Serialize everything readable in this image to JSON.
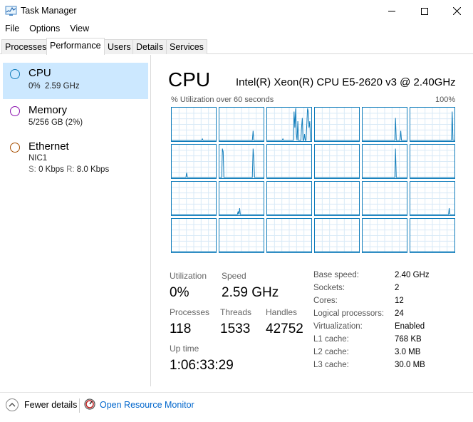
{
  "window": {
    "title": "Task Manager"
  },
  "menu": [
    "File",
    "Options",
    "View"
  ],
  "tabs": [
    "Processes",
    "Performance",
    "Users",
    "Details",
    "Services"
  ],
  "left": {
    "cpu": {
      "title": "CPU",
      "sub": "0%  2.59 GHz"
    },
    "memory": {
      "title": "Memory",
      "sub": "5/256 GB (2%)"
    },
    "ethernet": {
      "title": "Ethernet",
      "adapter": "NIC1",
      "s_label": "S:",
      "s_value": "0 Kbps",
      "r_label": "R:",
      "r_value": "8.0 Kbps"
    }
  },
  "main": {
    "title": "CPU",
    "model": "Intel(R) Xeon(R) CPU E5-2620 v3 @ 2.40GHz",
    "graph_label": "% Utilization over 60 seconds",
    "graph_max": "100%"
  },
  "stats": {
    "utilization_label": "Utilization",
    "utilization": "0%",
    "speed_label": "Speed",
    "speed": "2.59 GHz",
    "processes_label": "Processes",
    "processes": "118",
    "threads_label": "Threads",
    "threads": "1533",
    "handles_label": "Handles",
    "handles": "42752",
    "uptime_label": "Up time",
    "uptime": "1:06:33:29"
  },
  "info": [
    {
      "label": "Base speed:",
      "value": "2.40 GHz"
    },
    {
      "label": "Sockets:",
      "value": "2"
    },
    {
      "label": "Cores:",
      "value": "12"
    },
    {
      "label": "Logical processors:",
      "value": "24"
    },
    {
      "label": "Virtualization:",
      "value": "Enabled"
    },
    {
      "label": "L1 cache:",
      "value": "768 KB"
    },
    {
      "label": "L2 cache:",
      "value": "3.0 MB"
    },
    {
      "label": "L3 cache:",
      "value": "30.0 MB"
    }
  ],
  "bottom": {
    "fewer_details": "Fewer details",
    "resource_monitor": "Open Resource Monitor"
  },
  "colors": {
    "accent": "#117dbb",
    "selected": "#cce8ff",
    "cpu_circle": "#117dbb",
    "memory_circle": "#8b12ae",
    "ethernet_circle": "#a74f01",
    "link": "#0066cc"
  },
  "cpu_cores": [
    [
      0,
      0,
      0,
      0,
      0,
      0,
      0,
      0,
      0,
      0,
      0,
      0,
      0,
      0,
      0,
      0,
      0,
      0,
      0,
      0,
      0,
      0,
      0,
      0,
      0,
      0,
      0,
      0,
      0,
      0,
      0,
      0,
      0,
      0,
      0,
      0,
      0,
      0,
      0,
      0,
      0,
      5,
      0,
      0,
      0,
      0,
      0,
      0,
      0,
      0,
      0,
      0,
      0,
      0,
      0,
      0,
      0,
      0,
      0,
      0
    ],
    [
      0,
      0,
      0,
      0,
      0,
      0,
      0,
      0,
      0,
      0,
      0,
      0,
      0,
      0,
      0,
      0,
      0,
      0,
      0,
      0,
      0,
      0,
      0,
      0,
      0,
      0,
      0,
      0,
      0,
      0,
      0,
      0,
      0,
      0,
      0,
      0,
      0,
      0,
      0,
      0,
      0,
      0,
      0,
      0,
      0,
      30,
      0,
      0,
      0,
      0,
      0,
      0,
      0,
      0,
      0,
      0,
      0,
      0,
      0,
      0
    ],
    [
      0,
      0,
      0,
      0,
      0,
      0,
      0,
      0,
      0,
      0,
      0,
      0,
      0,
      0,
      0,
      0,
      0,
      0,
      0,
      0,
      0,
      5,
      0,
      0,
      0,
      0,
      0,
      0,
      0,
      0,
      0,
      0,
      0,
      0,
      0,
      0,
      90,
      40,
      100,
      20,
      0,
      60,
      0,
      0,
      0,
      0,
      40,
      70,
      0,
      0,
      20,
      0,
      0,
      50,
      100,
      90,
      40,
      60,
      0,
      0
    ],
    [
      0,
      0,
      0,
      0,
      0,
      0,
      0,
      0,
      0,
      0,
      0,
      0,
      0,
      0,
      0,
      0,
      0,
      0,
      0,
      0,
      0,
      0,
      0,
      0,
      0,
      0,
      0,
      0,
      0,
      0,
      0,
      0,
      0,
      0,
      0,
      0,
      0,
      0,
      0,
      0,
      0,
      0,
      0,
      0,
      0,
      0,
      0,
      0,
      0,
      0,
      0,
      0,
      0,
      0,
      0,
      0,
      0,
      0,
      0,
      0
    ],
    [
      0,
      0,
      0,
      0,
      0,
      0,
      0,
      0,
      0,
      0,
      0,
      0,
      0,
      0,
      0,
      0,
      0,
      0,
      0,
      0,
      0,
      0,
      0,
      0,
      0,
      0,
      0,
      0,
      0,
      0,
      0,
      0,
      0,
      0,
      0,
      0,
      0,
      0,
      0,
      0,
      0,
      0,
      0,
      0,
      70,
      0,
      0,
      0,
      0,
      0,
      0,
      30,
      0,
      0,
      0,
      0,
      0,
      0,
      0,
      0
    ],
    [
      0,
      0,
      0,
      0,
      0,
      0,
      0,
      0,
      0,
      0,
      0,
      0,
      0,
      0,
      0,
      0,
      0,
      0,
      0,
      0,
      0,
      0,
      0,
      0,
      0,
      0,
      0,
      0,
      0,
      0,
      0,
      0,
      0,
      0,
      0,
      0,
      0,
      0,
      0,
      0,
      0,
      0,
      0,
      0,
      0,
      0,
      0,
      0,
      0,
      0,
      0,
      0,
      0,
      0,
      0,
      0,
      90,
      0,
      0,
      0
    ],
    [
      0,
      0,
      0,
      0,
      0,
      0,
      0,
      0,
      0,
      0,
      0,
      0,
      0,
      0,
      0,
      0,
      0,
      0,
      0,
      0,
      15,
      0,
      0,
      0,
      0,
      0,
      0,
      0,
      0,
      0,
      0,
      0,
      0,
      0,
      0,
      0,
      0,
      0,
      0,
      0,
      0,
      0,
      0,
      0,
      0,
      0,
      0,
      0,
      0,
      0,
      0,
      0,
      0,
      0,
      0,
      0,
      0,
      0,
      0,
      0
    ],
    [
      0,
      0,
      0,
      0,
      90,
      80,
      0,
      0,
      0,
      0,
      0,
      0,
      0,
      0,
      0,
      0,
      0,
      0,
      0,
      0,
      0,
      0,
      0,
      0,
      0,
      0,
      0,
      0,
      0,
      0,
      0,
      0,
      0,
      0,
      0,
      0,
      0,
      0,
      0,
      0,
      0,
      0,
      0,
      0,
      0,
      90,
      60,
      0,
      0,
      0,
      0,
      0,
      0,
      0,
      0,
      0,
      0,
      0,
      0,
      0
    ],
    [
      0,
      0,
      0,
      0,
      0,
      0,
      0,
      0,
      0,
      0,
      0,
      0,
      0,
      0,
      0,
      0,
      0,
      0,
      0,
      0,
      0,
      0,
      0,
      0,
      0,
      0,
      0,
      0,
      0,
      0,
      0,
      0,
      0,
      0,
      0,
      0,
      0,
      0,
      0,
      0,
      0,
      0,
      0,
      0,
      0,
      0,
      0,
      0,
      0,
      0,
      0,
      0,
      0,
      0,
      0,
      0,
      0,
      0,
      0,
      0
    ],
    [
      0,
      0,
      0,
      0,
      0,
      0,
      0,
      0,
      0,
      0,
      0,
      0,
      0,
      0,
      0,
      0,
      0,
      0,
      0,
      0,
      0,
      0,
      0,
      0,
      0,
      0,
      0,
      0,
      0,
      0,
      0,
      0,
      0,
      0,
      0,
      0,
      0,
      0,
      0,
      0,
      0,
      0,
      0,
      0,
      0,
      0,
      0,
      0,
      0,
      0,
      0,
      0,
      0,
      0,
      0,
      0,
      0,
      0,
      0,
      0
    ],
    [
      0,
      0,
      0,
      0,
      0,
      0,
      0,
      0,
      0,
      0,
      0,
      0,
      0,
      0,
      0,
      0,
      0,
      0,
      0,
      0,
      0,
      0,
      0,
      0,
      0,
      0,
      0,
      0,
      0,
      0,
      0,
      0,
      0,
      0,
      0,
      0,
      0,
      0,
      0,
      0,
      0,
      0,
      0,
      0,
      90,
      0,
      0,
      0,
      0,
      0,
      0,
      0,
      0,
      0,
      0,
      0,
      0,
      0,
      0,
      0
    ],
    [
      0,
      0,
      0,
      0,
      0,
      0,
      0,
      0,
      0,
      0,
      0,
      0,
      0,
      0,
      0,
      0,
      0,
      0,
      0,
      0,
      0,
      0,
      0,
      0,
      0,
      0,
      0,
      0,
      0,
      0,
      0,
      0,
      0,
      0,
      0,
      0,
      0,
      0,
      0,
      0,
      0,
      0,
      0,
      0,
      0,
      0,
      0,
      0,
      0,
      0,
      0,
      0,
      0,
      0,
      0,
      0,
      0,
      0,
      0,
      0
    ],
    [
      0,
      0,
      0,
      0,
      0,
      0,
      0,
      0,
      0,
      0,
      0,
      0,
      0,
      0,
      0,
      0,
      0,
      0,
      0,
      0,
      0,
      0,
      0,
      0,
      0,
      0,
      0,
      0,
      0,
      0,
      0,
      0,
      0,
      0,
      0,
      0,
      0,
      0,
      0,
      0,
      0,
      0,
      0,
      0,
      0,
      0,
      0,
      0,
      0,
      0,
      0,
      0,
      0,
      0,
      0,
      0,
      0,
      0,
      0,
      0
    ],
    [
      0,
      0,
      0,
      0,
      0,
      0,
      0,
      0,
      0,
      0,
      0,
      0,
      0,
      0,
      0,
      0,
      0,
      0,
      0,
      0,
      0,
      0,
      0,
      0,
      0,
      10,
      0,
      20,
      0,
      0,
      0,
      0,
      0,
      0,
      0,
      0,
      0,
      0,
      0,
      0,
      0,
      0,
      0,
      0,
      0,
      0,
      0,
      0,
      0,
      0,
      0,
      0,
      0,
      0,
      0,
      0,
      0,
      0,
      0,
      0
    ],
    [
      0,
      0,
      0,
      0,
      0,
      0,
      0,
      0,
      0,
      0,
      0,
      0,
      0,
      0,
      0,
      0,
      0,
      0,
      0,
      0,
      0,
      0,
      0,
      0,
      0,
      0,
      0,
      0,
      0,
      0,
      0,
      0,
      0,
      0,
      0,
      0,
      0,
      0,
      0,
      0,
      0,
      0,
      0,
      0,
      0,
      0,
      0,
      0,
      0,
      0,
      0,
      0,
      0,
      0,
      0,
      0,
      0,
      0,
      0,
      0
    ],
    [
      0,
      0,
      0,
      0,
      0,
      0,
      0,
      0,
      0,
      0,
      0,
      0,
      0,
      0,
      0,
      0,
      0,
      0,
      0,
      0,
      0,
      0,
      0,
      0,
      0,
      0,
      0,
      0,
      0,
      0,
      0,
      0,
      0,
      0,
      0,
      0,
      0,
      0,
      0,
      0,
      0,
      0,
      0,
      0,
      0,
      0,
      0,
      0,
      0,
      0,
      0,
      0,
      0,
      0,
      0,
      0,
      0,
      0,
      0,
      0
    ],
    [
      0,
      0,
      0,
      0,
      0,
      0,
      0,
      0,
      0,
      0,
      0,
      0,
      0,
      0,
      0,
      0,
      0,
      0,
      0,
      0,
      0,
      0,
      0,
      0,
      0,
      0,
      0,
      0,
      0,
      0,
      0,
      0,
      0,
      0,
      0,
      0,
      0,
      0,
      0,
      0,
      0,
      0,
      0,
      0,
      0,
      0,
      0,
      0,
      0,
      0,
      0,
      0,
      0,
      0,
      0,
      0,
      0,
      0,
      0,
      0
    ],
    [
      0,
      0,
      0,
      0,
      0,
      0,
      0,
      0,
      0,
      0,
      0,
      0,
      0,
      0,
      0,
      0,
      0,
      0,
      0,
      0,
      0,
      0,
      0,
      0,
      0,
      0,
      0,
      0,
      0,
      0,
      0,
      0,
      0,
      0,
      0,
      0,
      0,
      0,
      0,
      0,
      0,
      0,
      0,
      0,
      0,
      0,
      0,
      0,
      0,
      0,
      0,
      0,
      20,
      0,
      0,
      0,
      0,
      0,
      0,
      0
    ],
    [
      0,
      0,
      0,
      0,
      0,
      0,
      0,
      0,
      0,
      0,
      0,
      0,
      0,
      0,
      0,
      0,
      0,
      0,
      0,
      0,
      0,
      0,
      0,
      0,
      0,
      0,
      0,
      0,
      0,
      0,
      0,
      0,
      0,
      0,
      0,
      0,
      0,
      0,
      0,
      0,
      0,
      0,
      0,
      0,
      0,
      0,
      0,
      0,
      0,
      0,
      0,
      0,
      0,
      0,
      0,
      0,
      0,
      0,
      0,
      0
    ],
    [
      0,
      0,
      0,
      0,
      0,
      0,
      0,
      0,
      0,
      0,
      0,
      0,
      0,
      0,
      0,
      0,
      0,
      0,
      0,
      0,
      0,
      0,
      0,
      0,
      0,
      0,
      0,
      0,
      0,
      0,
      0,
      0,
      0,
      0,
      0,
      0,
      0,
      0,
      0,
      0,
      0,
      0,
      0,
      0,
      0,
      0,
      0,
      0,
      0,
      0,
      0,
      0,
      0,
      0,
      0,
      0,
      0,
      0,
      0,
      0
    ],
    [
      0,
      0,
      0,
      0,
      0,
      0,
      0,
      0,
      0,
      0,
      0,
      0,
      0,
      0,
      0,
      0,
      0,
      0,
      0,
      0,
      0,
      0,
      0,
      0,
      0,
      0,
      0,
      0,
      0,
      0,
      0,
      0,
      0,
      0,
      0,
      0,
      0,
      0,
      0,
      0,
      0,
      0,
      0,
      0,
      0,
      0,
      0,
      0,
      0,
      0,
      0,
      0,
      0,
      0,
      0,
      0,
      0,
      0,
      0,
      0
    ],
    [
      0,
      0,
      0,
      0,
      0,
      0,
      0,
      0,
      0,
      0,
      0,
      0,
      0,
      0,
      0,
      0,
      0,
      0,
      0,
      0,
      0,
      0,
      0,
      0,
      0,
      0,
      0,
      0,
      0,
      0,
      0,
      0,
      0,
      0,
      0,
      0,
      0,
      0,
      0,
      0,
      0,
      0,
      0,
      0,
      0,
      0,
      0,
      0,
      0,
      0,
      0,
      0,
      0,
      0,
      0,
      0,
      0,
      0,
      0,
      0
    ],
    [
      0,
      0,
      0,
      0,
      0,
      0,
      0,
      0,
      0,
      0,
      0,
      0,
      0,
      0,
      0,
      0,
      0,
      0,
      0,
      0,
      0,
      0,
      0,
      0,
      0,
      0,
      0,
      0,
      0,
      0,
      0,
      0,
      0,
      0,
      0,
      0,
      0,
      0,
      0,
      0,
      0,
      0,
      0,
      0,
      0,
      0,
      0,
      0,
      0,
      0,
      0,
      0,
      0,
      0,
      0,
      0,
      0,
      0,
      0,
      0
    ],
    [
      0,
      0,
      0,
      0,
      0,
      0,
      0,
      0,
      0,
      0,
      0,
      0,
      0,
      0,
      0,
      0,
      0,
      0,
      0,
      0,
      0,
      0,
      0,
      0,
      0,
      0,
      0,
      0,
      0,
      0,
      0,
      0,
      0,
      0,
      0,
      0,
      0,
      0,
      0,
      0,
      0,
      0,
      0,
      0,
      0,
      0,
      0,
      0,
      0,
      0,
      0,
      0,
      0,
      0,
      0,
      0,
      0,
      0,
      0,
      0
    ]
  ]
}
